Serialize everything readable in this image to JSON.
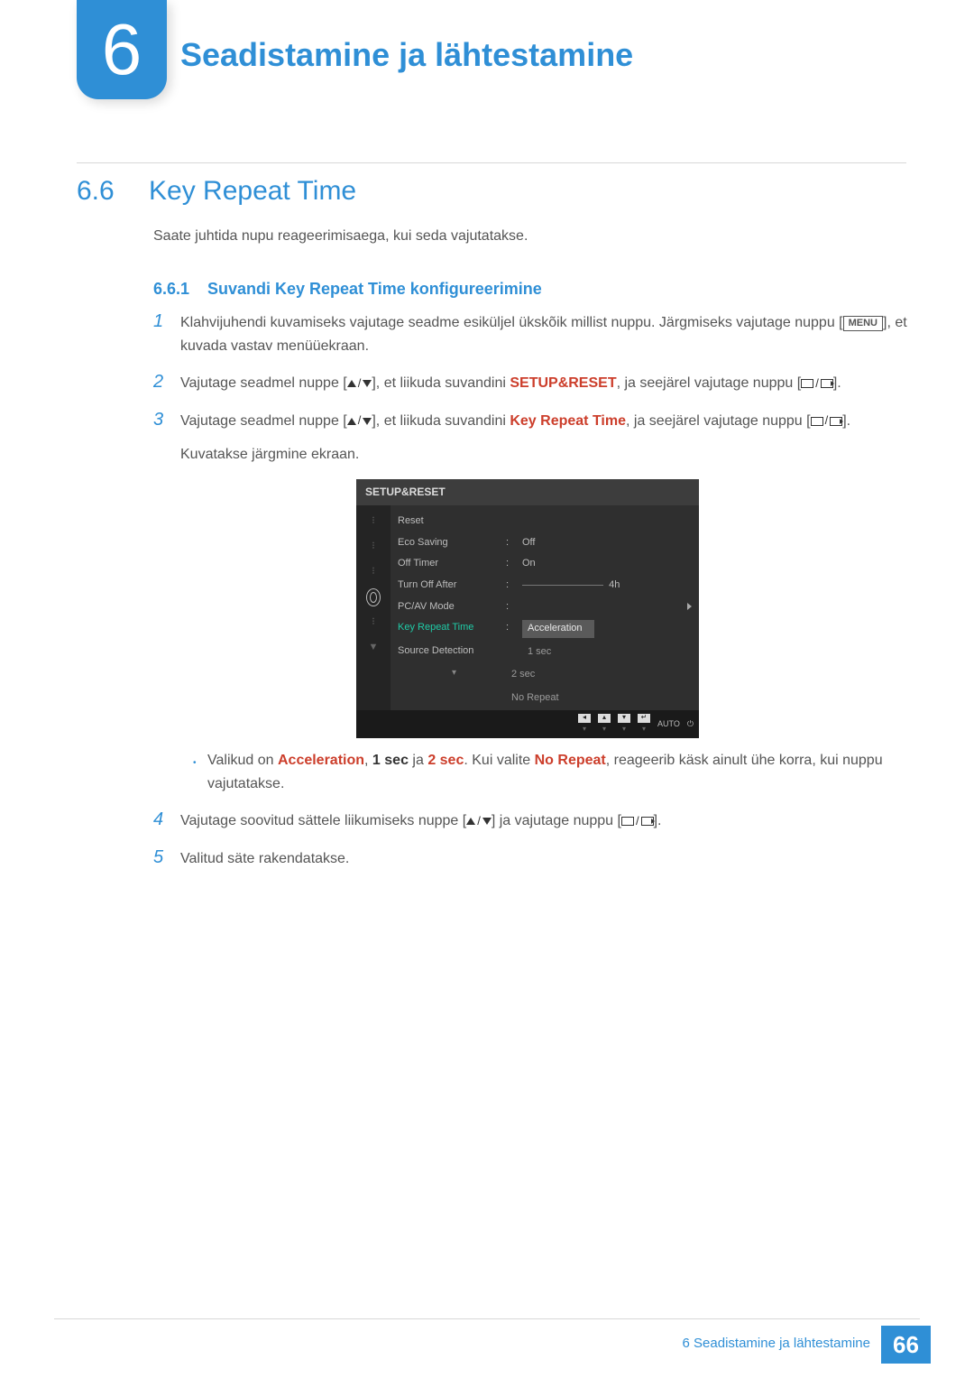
{
  "header": {
    "chapter_number": "6",
    "chapter_title": "Seadistamine ja lähtestamine"
  },
  "section": {
    "number": "6.6",
    "title": "Key Repeat Time",
    "intro": "Saate juhtida nupu reageerimisaega, kui seda vajutatakse."
  },
  "subsection": {
    "number": "6.6.1",
    "title": "Suvandi Key Repeat Time konfigureerimine"
  },
  "steps": {
    "s1": {
      "num": "1",
      "text_a": "Klahvijuhendi kuvamiseks vajutage seadme esiküljel ükskõik millist nuppu. Järgmiseks vajutage nuppu [",
      "menu": "MENU",
      "text_b": "], et kuvada vastav menüüekraan."
    },
    "s2": {
      "num": "2",
      "text_a": "Vajutage seadmel nuppe [",
      "text_b": "], et liikuda suvandini ",
      "target": "SETUP&RESET",
      "text_c": ", ja seejärel vajutage nuppu [",
      "text_d": "]."
    },
    "s3": {
      "num": "3",
      "text_a": "Vajutage seadmel nuppe [",
      "text_b": "], et liikuda suvandini ",
      "target": "Key Repeat Time",
      "text_c": ", ja seejärel vajutage nuppu [",
      "text_d": "].",
      "after": "Kuvatakse järgmine ekraan.",
      "bullet_a": "Valikud on ",
      "opt1": "Acceleration",
      "sep1": ", ",
      "opt2": "1 sec",
      "sep2": " ja ",
      "opt3": "2 sec",
      "sep3": ". Kui valite ",
      "opt4": "No Repeat",
      "bullet_b": ", reageerib käsk ainult ühe korra, kui nuppu vajutatakse."
    },
    "s4": {
      "num": "4",
      "text_a": "Vajutage soovitud sättele liikumiseks nuppe [",
      "text_b": "] ja vajutage nuppu [",
      "text_c": "]."
    },
    "s5": {
      "num": "5",
      "text": "Valitud säte rakendatakse."
    }
  },
  "osd": {
    "title": "SETUP&RESET",
    "rows": {
      "reset": "Reset",
      "eco": "Eco Saving",
      "eco_val": "Off",
      "offtimer": "Off Timer",
      "offtimer_val": "On",
      "turnoff": "Turn Off After",
      "turnoff_val": "4h",
      "pcav": "PC/AV Mode",
      "krt": "Key Repeat Time",
      "src": "Source Detection",
      "options": {
        "o1": "Acceleration",
        "o2": "1 sec",
        "o3": "2 sec",
        "o4": "No Repeat"
      }
    },
    "tabs_down": "▼",
    "bottom": {
      "auto": "AUTO"
    }
  },
  "footer": {
    "text": "6 Seadistamine ja lähtestamine",
    "page": "66"
  }
}
